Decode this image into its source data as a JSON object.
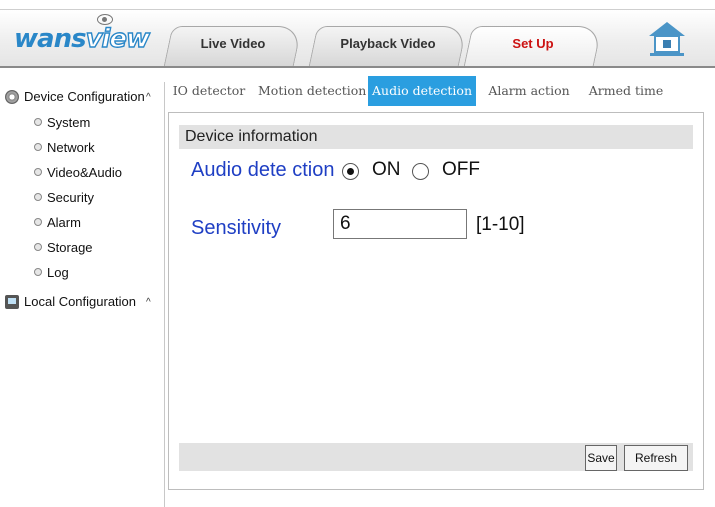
{
  "brand": {
    "logo_part1": "wans",
    "logo_part2": "view"
  },
  "header": {
    "tabs": [
      {
        "label": "Live Video",
        "active": false
      },
      {
        "label": "Playback Video",
        "active": false
      },
      {
        "label": "Set Up",
        "active": true
      }
    ],
    "home_icon": "home-icon"
  },
  "sidebar": {
    "device_configuration": "Device Configuration",
    "items": [
      "System",
      "Network",
      "Video&Audio",
      "Security",
      "Alarm",
      "Storage",
      "Log"
    ],
    "local_configuration": "Local Configuration",
    "caret": "^"
  },
  "subtabs": [
    {
      "label": "IO detector",
      "active": false
    },
    {
      "label": "Motion detection",
      "active": false
    },
    {
      "label": "Audio detection",
      "active": true
    },
    {
      "label": "Alarm action",
      "active": false
    },
    {
      "label": "Armed time",
      "active": false
    }
  ],
  "panel": {
    "title": "Device information",
    "audio_detection_label": "Audio dete ction",
    "on_label": "ON",
    "off_label": "OFF",
    "selected": "ON",
    "sensitivity_label": "Sensitivity",
    "sensitivity_value": "6",
    "sensitivity_range": "[1-10]",
    "save_label": "Save",
    "refresh_label": "Refresh"
  },
  "colors": {
    "accent": "#2a9ee0",
    "active_tab_text": "#cc1111",
    "label_blue": "#1f3fc4"
  }
}
